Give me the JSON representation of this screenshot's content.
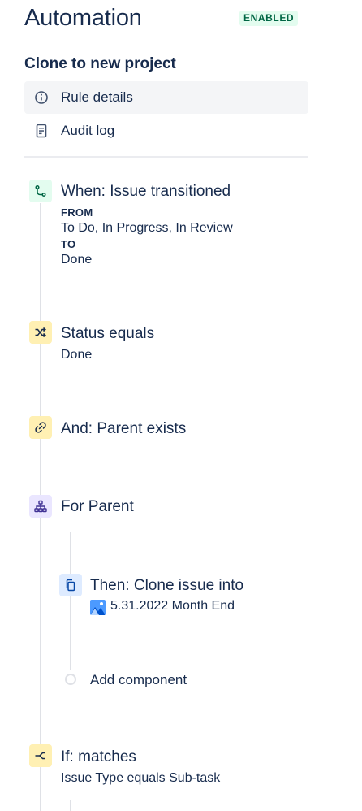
{
  "header": {
    "title": "Automation",
    "status_badge": "ENABLED"
  },
  "rule": {
    "name": "Clone to new project"
  },
  "nav": {
    "items": [
      {
        "label": "Rule details",
        "icon": "info-icon",
        "selected": true
      },
      {
        "label": "Audit log",
        "icon": "document-icon",
        "selected": false
      }
    ]
  },
  "steps": {
    "trigger": {
      "title": "When: Issue transitioned",
      "from_label": "FROM",
      "from_value": "To Do, In Progress, In Review",
      "to_label": "TO",
      "to_value": "Done",
      "icon": "branch-icon"
    },
    "condition1": {
      "title": "Status equals",
      "value": "Done",
      "icon": "shuffle-icon"
    },
    "condition2": {
      "title": "And: Parent exists",
      "icon": "link-icon"
    },
    "branch": {
      "title": "For Parent",
      "icon": "hierarchy-icon"
    },
    "action": {
      "title": "Then: Clone issue into",
      "project": "5.31.2022 Month End",
      "icon": "copy-icon",
      "project_icon": "project-avatar-icon"
    },
    "add_component": {
      "label": "Add component"
    },
    "condition3": {
      "title": "If: matches",
      "value": "Issue Type equals Sub-task",
      "icon": "fork-icon"
    }
  },
  "colors": {
    "text": "#172b4d",
    "badge_bg": "#e3fcef",
    "badge_text": "#006644",
    "trigger_icon_bg": "#e3fcef",
    "condition_icon_bg": "#fff0b3",
    "branch_icon_bg": "#eae6ff",
    "action_icon_bg": "#deebff"
  }
}
